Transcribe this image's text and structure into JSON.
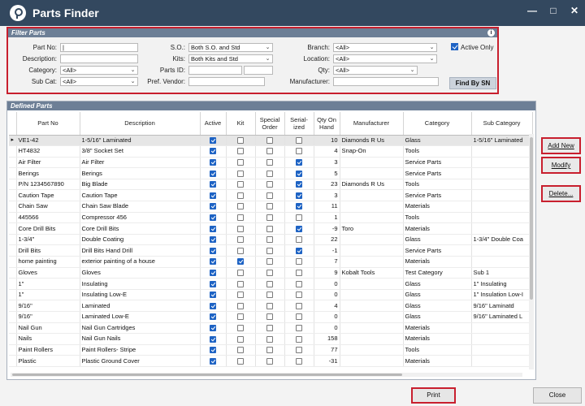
{
  "window": {
    "title": "Parts Finder",
    "minimize": "—",
    "maximize": "□",
    "close": "✕"
  },
  "filter": {
    "header": "Filter Parts",
    "info_icon": "info-icon",
    "part_no_label": "Part No:",
    "part_no_value": "|",
    "description_label": "Description:",
    "description_value": "",
    "category_label": "Category:",
    "category_value": "<All>",
    "subcat_label": "Sub Cat:",
    "subcat_value": "<All>",
    "so_label": "S.O.:",
    "so_value": "Both S.O. and Std",
    "kits_label": "Kits:",
    "kits_value": "Both Kits and Std",
    "partsid_label": "Parts ID:",
    "partsid_value": "",
    "vendor_label": "Pref. Vendor:",
    "vendor_value": "",
    "branch_label": "Branch:",
    "branch_value": "<All>",
    "location_label": "Location:",
    "location_value": "<All>",
    "qty_label": "Qty:",
    "qty_value": "<All>",
    "manufacturer_label": "Manufacturer:",
    "manufacturer_value": "",
    "active_only_label": "Active Only",
    "active_only_checked": true,
    "find_by_sn": "Find By SN"
  },
  "parts": {
    "header": "Defined Parts",
    "columns": [
      "",
      "Part No",
      "Description",
      "Active",
      "Kit",
      "Special Order",
      "Serial-ized",
      "Qty On Hand",
      "Manufacturer",
      "Category",
      "Sub Category"
    ],
    "rows": [
      {
        "part": "VE1-42",
        "desc": "1-5/16\" Laminated",
        "active": true,
        "kit": false,
        "so": false,
        "serial": false,
        "qty": "10",
        "mfr": "Diamonds R Us",
        "cat": "Glass",
        "sub": "1-5/16\" Laminated",
        "selected": true
      },
      {
        "part": "HT4832",
        "desc": "3/8\" Socket Set",
        "active": true,
        "kit": false,
        "so": false,
        "serial": false,
        "qty": "4",
        "mfr": "Snap-On",
        "cat": "Tools",
        "sub": ""
      },
      {
        "part": "Air Filter",
        "desc": "Air Filter",
        "active": true,
        "kit": false,
        "so": false,
        "serial": true,
        "qty": "3",
        "mfr": "",
        "cat": "Service Parts",
        "sub": ""
      },
      {
        "part": "Berings",
        "desc": "Berings",
        "active": true,
        "kit": false,
        "so": false,
        "serial": true,
        "qty": "5",
        "mfr": "",
        "cat": "Service Parts",
        "sub": ""
      },
      {
        "part": "P/N 1234567890",
        "desc": "Big Blade",
        "active": true,
        "kit": false,
        "so": false,
        "serial": true,
        "qty": "23",
        "mfr": "Diamonds R Us",
        "cat": "Tools",
        "sub": ""
      },
      {
        "part": "Caution Tape",
        "desc": "Caution Tape",
        "active": true,
        "kit": false,
        "so": false,
        "serial": true,
        "qty": "3",
        "mfr": "",
        "cat": "Service Parts",
        "sub": ""
      },
      {
        "part": "Chain Saw",
        "desc": "Chain Saw Blade",
        "active": true,
        "kit": false,
        "so": false,
        "serial": true,
        "qty": "11",
        "mfr": "",
        "cat": "Materials",
        "sub": ""
      },
      {
        "part": "445566",
        "desc": "Compressor 456",
        "active": true,
        "kit": false,
        "so": false,
        "serial": false,
        "qty": "1",
        "mfr": "",
        "cat": "Tools",
        "sub": ""
      },
      {
        "part": "Core Drill Bits",
        "desc": "Core Drill Bits",
        "active": true,
        "kit": false,
        "so": false,
        "serial": true,
        "qty": "-9",
        "mfr": "Toro",
        "cat": "Materials",
        "sub": ""
      },
      {
        "part": "1-3/4\"",
        "desc": "Double Coating",
        "active": true,
        "kit": false,
        "so": false,
        "serial": false,
        "qty": "22",
        "mfr": "",
        "cat": "Glass",
        "sub": "1-3/4\" Double Coa"
      },
      {
        "part": "Drill Bits",
        "desc": "Drill Bits Hand Drill",
        "active": true,
        "kit": false,
        "so": false,
        "serial": true,
        "qty": "-1",
        "mfr": "",
        "cat": "Service Parts",
        "sub": ""
      },
      {
        "part": "home painting",
        "desc": "exterior painting of a house",
        "active": true,
        "kit": true,
        "so": false,
        "serial": false,
        "qty": "7",
        "mfr": "",
        "cat": "Materials",
        "sub": ""
      },
      {
        "part": "Gloves",
        "desc": "Gloves",
        "active": true,
        "kit": false,
        "so": false,
        "serial": false,
        "qty": "9",
        "mfr": "Kobalt Tools",
        "cat": "Test Category",
        "sub": "Sub 1"
      },
      {
        "part": "1\"",
        "desc": "Insulating",
        "active": true,
        "kit": false,
        "so": false,
        "serial": false,
        "qty": "0",
        "mfr": "",
        "cat": "Glass",
        "sub": "1\" Insulating"
      },
      {
        "part": "1\"",
        "desc": "Insulating Low-E",
        "active": true,
        "kit": false,
        "so": false,
        "serial": false,
        "qty": "0",
        "mfr": "",
        "cat": "Glass",
        "sub": "1\" Insulation Low-I"
      },
      {
        "part": "9/16\"",
        "desc": "Laminated",
        "active": true,
        "kit": false,
        "so": false,
        "serial": false,
        "qty": "4",
        "mfr": "",
        "cat": "Glass",
        "sub": "9/16\" Laminatd"
      },
      {
        "part": "9/16\"",
        "desc": "Laminated Low-E",
        "active": true,
        "kit": false,
        "so": false,
        "serial": false,
        "qty": "0",
        "mfr": "",
        "cat": "Glass",
        "sub": "9/16\" Laminated L"
      },
      {
        "part": "Nail Gun",
        "desc": "Nail Gun Cartridges",
        "active": true,
        "kit": false,
        "so": false,
        "serial": false,
        "qty": "0",
        "mfr": "",
        "cat": "Materials",
        "sub": ""
      },
      {
        "part": "Nails",
        "desc": "Nail Gun Nails",
        "active": true,
        "kit": false,
        "so": false,
        "serial": false,
        "qty": "158",
        "mfr": "",
        "cat": "Materials",
        "sub": ""
      },
      {
        "part": "Paint Rollers",
        "desc": "Paint Rollers- Stripe",
        "active": true,
        "kit": false,
        "so": false,
        "serial": false,
        "qty": "77",
        "mfr": "",
        "cat": "Tools",
        "sub": ""
      },
      {
        "part": "Plastic",
        "desc": "Plastic Ground Cover",
        "active": true,
        "kit": false,
        "so": false,
        "serial": false,
        "qty": "-31",
        "mfr": "",
        "cat": "Materials",
        "sub": ""
      }
    ]
  },
  "actions": {
    "add_new": "Add New",
    "modify": "Modify",
    "delete": "Delete...",
    "print": "Print",
    "close": "Close"
  },
  "colors": {
    "highlight": "#c81f2e",
    "titlebar": "#33485f",
    "panel_header": "#6d7f96",
    "checked": "#1e63c4"
  }
}
